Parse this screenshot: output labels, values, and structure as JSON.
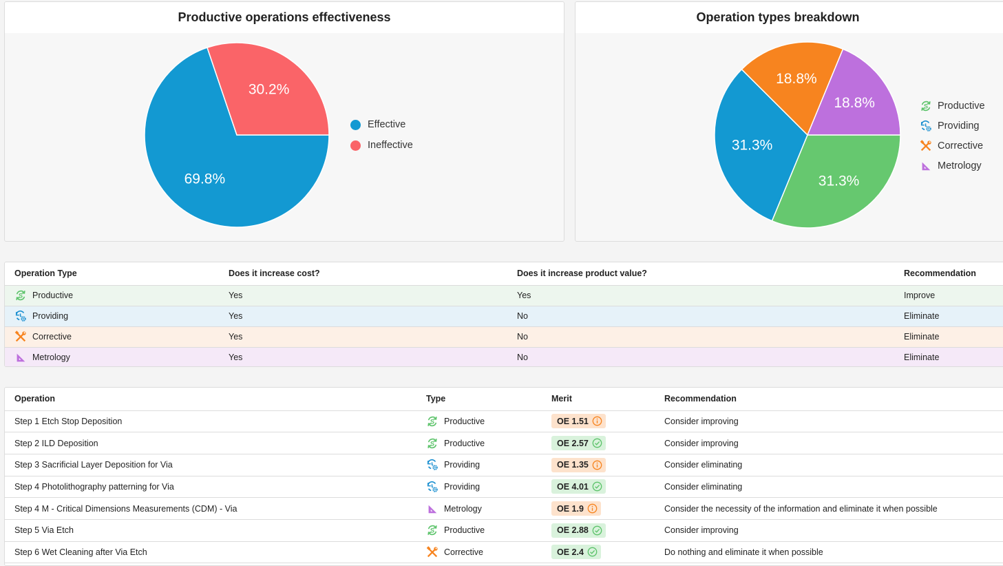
{
  "charts": [
    {
      "title": "Productive operations effectiveness",
      "legend": [
        "Effective",
        "Ineffective"
      ]
    },
    {
      "title": "Operation types breakdown",
      "legend": [
        "Productive",
        "Providing",
        "Corrective",
        "Metrology"
      ]
    }
  ],
  "chart_data": [
    {
      "type": "pie",
      "title": "Productive operations effectiveness",
      "categories": [
        "Effective",
        "Ineffective"
      ],
      "values": [
        69.8,
        30.2
      ],
      "labels": [
        "69.8%",
        "30.2%"
      ],
      "colors": [
        "#1399d2",
        "#fa6468"
      ],
      "legend_position": "right"
    },
    {
      "type": "pie",
      "title": "Operation types breakdown",
      "categories": [
        "Productive",
        "Providing",
        "Corrective",
        "Metrology"
      ],
      "values": [
        31.3,
        31.3,
        18.8,
        18.8
      ],
      "labels": [
        "31.3%",
        "31.3%",
        "18.8%",
        "18.8%"
      ],
      "colors": [
        "#66c86f",
        "#1399d2",
        "#f7841f",
        "#bd70dd"
      ],
      "legend_position": "right"
    }
  ],
  "icons": {
    "Productive": {
      "name": "productive-icon",
      "color": "#5cc36a"
    },
    "Providing": {
      "name": "providing-icon",
      "color": "#1a8fd0"
    },
    "Corrective": {
      "name": "corrective-icon",
      "color": "#f7841f"
    },
    "Metrology": {
      "name": "metrology-icon",
      "color": "#bd70dd"
    }
  },
  "types_table": {
    "headers": [
      "Operation Type",
      "Does it increase cost?",
      "Does it increase product value?",
      "Recommendation"
    ],
    "rows": [
      {
        "type": "Productive",
        "cost": "Yes",
        "value": "Yes",
        "recommendation": "Improve"
      },
      {
        "type": "Providing",
        "cost": "Yes",
        "value": "No",
        "recommendation": "Eliminate"
      },
      {
        "type": "Corrective",
        "cost": "Yes",
        "value": "No",
        "recommendation": "Eliminate"
      },
      {
        "type": "Metrology",
        "cost": "Yes",
        "value": "No",
        "recommendation": "Eliminate"
      }
    ]
  },
  "ops_table": {
    "headers": [
      "Operation",
      "Type",
      "Merit",
      "Recommendation"
    ],
    "rows": [
      {
        "operation": "Step 1 Etch Stop Deposition",
        "type": "Productive",
        "merit": "OE 1.51",
        "status": "warning",
        "recommendation": "Consider improving"
      },
      {
        "operation": "Step 2 ILD Deposition",
        "type": "Productive",
        "merit": "OE 2.57",
        "status": "ok",
        "recommendation": "Consider improving"
      },
      {
        "operation": "Step 3 Sacrificial Layer Deposition for Via",
        "type": "Providing",
        "merit": "OE 1.35",
        "status": "warning",
        "recommendation": "Consider eliminating"
      },
      {
        "operation": "Step 4 Photolithography patterning for Via",
        "type": "Providing",
        "merit": "OE 4.01",
        "status": "ok",
        "recommendation": "Consider eliminating"
      },
      {
        "operation": "Step 4 M - Critical Dimensions Measurements (CDM) - Via",
        "type": "Metrology",
        "merit": "OE 1.9",
        "status": "warning",
        "recommendation": "Consider the necessity of the information and eliminate it when possible"
      },
      {
        "operation": "Step 5 Via Etch",
        "type": "Productive",
        "merit": "OE 2.88",
        "status": "ok",
        "recommendation": "Consider improving"
      },
      {
        "operation": "Step 6 Wet Cleaning after Via Etch",
        "type": "Corrective",
        "merit": "OE 2.4",
        "status": "ok",
        "recommendation": "Do nothing and eliminate it when possible"
      }
    ]
  }
}
